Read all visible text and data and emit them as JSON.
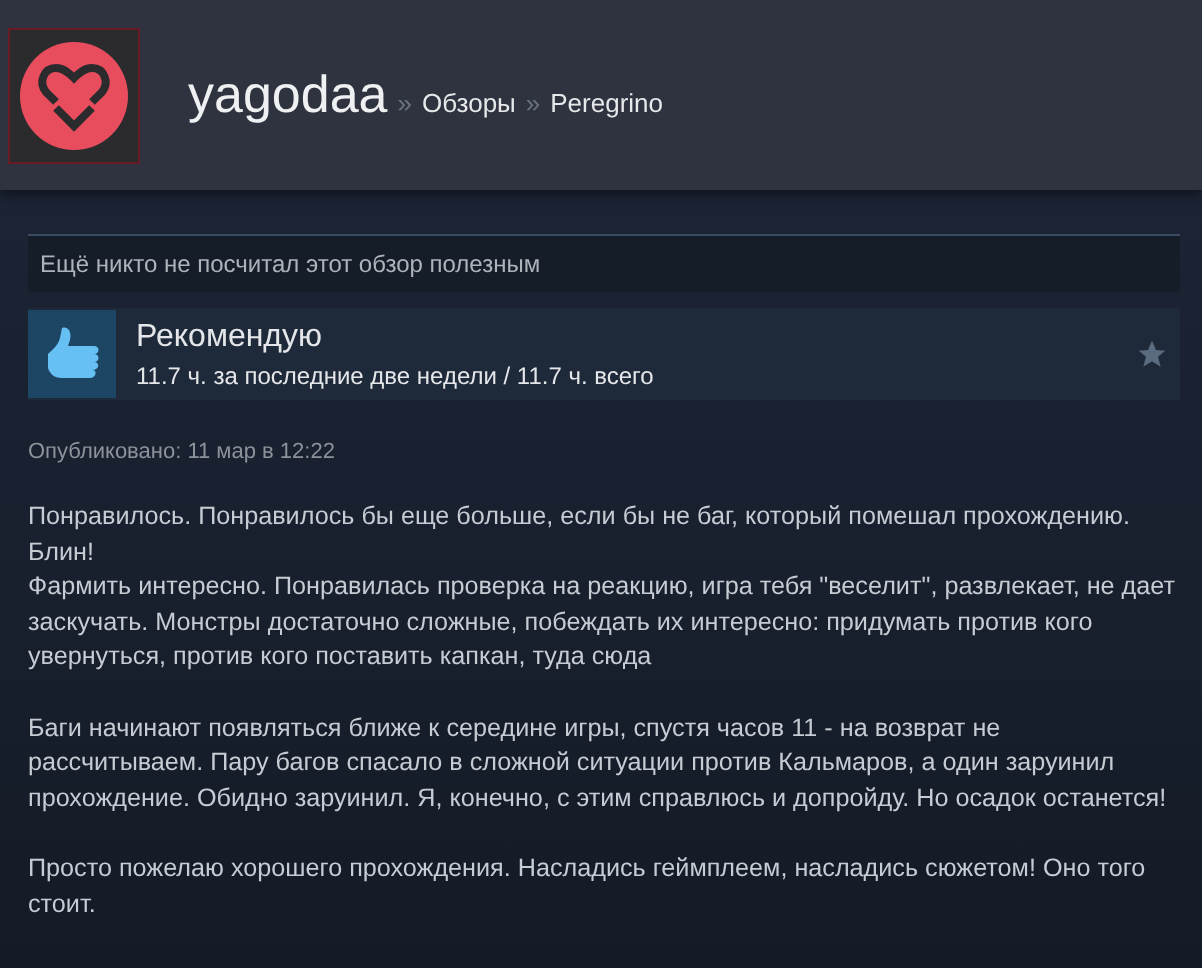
{
  "header": {
    "username": "yagodaa",
    "breadcrumbs": [
      {
        "separator": "»",
        "label": "Обзоры"
      },
      {
        "separator": "»",
        "label": "Peregrino"
      }
    ]
  },
  "helpful": "Ещё никто не посчитал этот обзор полезным",
  "verdict": {
    "title": "Рекомендую",
    "hours": "11.7 ч. за последние две недели / 11.7 ч. всего"
  },
  "posted": "Опубликовано: 11 мар в 12:22",
  "review": [
    [
      "Понравилось. Понравилось бы еще больше, если бы не баг, который помешал прохождению. Блин!",
      "Фармить интересно. Понравилась проверка на реакцию, игра тебя \"веселит\", развлекает, не дает заскучать. Монстры достаточно сложные, побеждать их интересно: придумать против кого увернуться, против кого поставить капкан, туда сюда"
    ],
    [
      "Баги начинают появляться ближе к середине игры, спустя часов 11 - на возврат не рассчитываем. Пару багов спасало в сложной ситуации против Кальмаров, а один заруинил прохождение. Обидно заруинил. Я, конечно, с этим справлюсь и допройду. Но осадок останется!"
    ],
    [
      "Просто пожелаю хорошего прохождения. Насладись геймплеем, насладись сюжетом! Оно того стоит."
    ]
  ]
}
